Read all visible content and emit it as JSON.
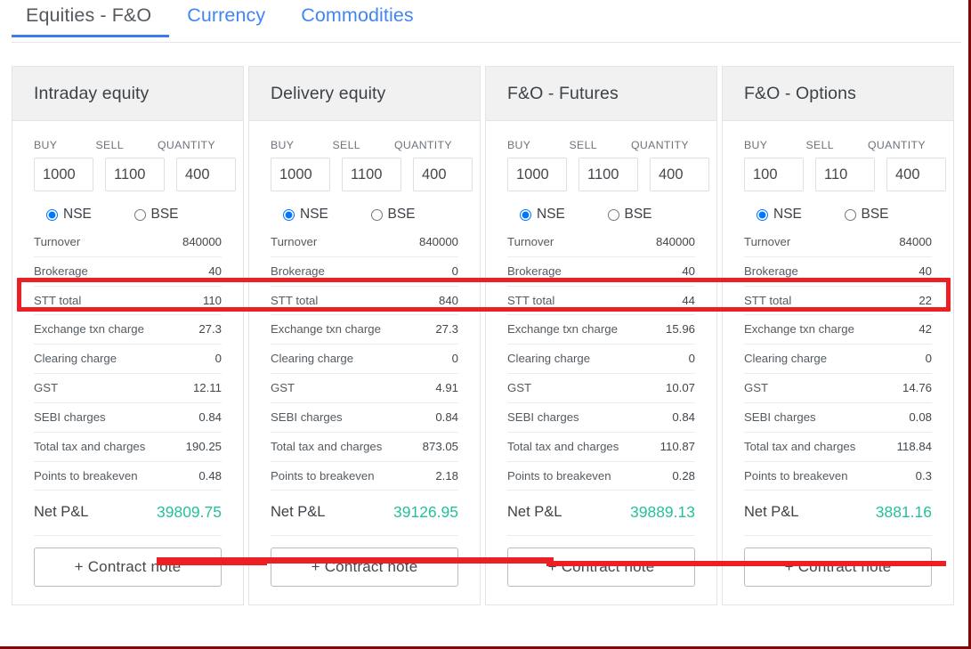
{
  "tabs": [
    {
      "label": "Equities - F&O",
      "active": true
    },
    {
      "label": "Currency",
      "active": false
    },
    {
      "label": "Commodities",
      "active": false
    }
  ],
  "field_labels": {
    "buy": "BUY",
    "sell": "SELL",
    "quantity": "QUANTITY"
  },
  "exchanges": {
    "nse": "NSE",
    "bse": "BSE"
  },
  "row_labels": {
    "turnover": "Turnover",
    "brokerage": "Brokerage",
    "stt_total": "STT total",
    "exchange_txn_charge": "Exchange txn charge",
    "clearing_charge": "Clearing charge",
    "gst": "GST",
    "sebi_charges": "SEBI charges",
    "total_tax_and_charges": "Total tax and charges",
    "points_to_breakeven": "Points to breakeven",
    "net_pl": "Net P&L"
  },
  "contract_note_label": "+ Contract note",
  "colors": {
    "accent_blue": "#3f7ceb",
    "tab_link": "#4285f4",
    "profit_green": "#26c09a",
    "annotation_red": "#ec2024",
    "page_border_red": "#7d0a0a",
    "card_header_bg": "#f1f1f1"
  },
  "annotations": {
    "brokerage_highlight": "red rectangle around the Brokerage row across all four cards",
    "netpl_underline": "red underline beneath the Net P&L row across all four cards"
  },
  "cards": [
    {
      "title": "Intraday equity",
      "buy": "1000",
      "sell": "1100",
      "quantity": "400",
      "exchange_selected": "NSE",
      "values": {
        "turnover": "840000",
        "brokerage": "40",
        "stt_total": "110",
        "exchange_txn_charge": "27.3",
        "clearing_charge": "0",
        "gst": "12.11",
        "sebi_charges": "0.84",
        "total_tax_and_charges": "190.25",
        "points_to_breakeven": "0.48",
        "net_pl": "39809.75"
      }
    },
    {
      "title": "Delivery equity",
      "buy": "1000",
      "sell": "1100",
      "quantity": "400",
      "exchange_selected": "NSE",
      "values": {
        "turnover": "840000",
        "brokerage": "0",
        "stt_total": "840",
        "exchange_txn_charge": "27.3",
        "clearing_charge": "0",
        "gst": "4.91",
        "sebi_charges": "0.84",
        "total_tax_and_charges": "873.05",
        "points_to_breakeven": "2.18",
        "net_pl": "39126.95"
      }
    },
    {
      "title": "F&O - Futures",
      "buy": "1000",
      "sell": "1100",
      "quantity": "400",
      "exchange_selected": "NSE",
      "values": {
        "turnover": "840000",
        "brokerage": "40",
        "stt_total": "44",
        "exchange_txn_charge": "15.96",
        "clearing_charge": "0",
        "gst": "10.07",
        "sebi_charges": "0.84",
        "total_tax_and_charges": "110.87",
        "points_to_breakeven": "0.28",
        "net_pl": "39889.13"
      }
    },
    {
      "title": "F&O - Options",
      "buy": "100",
      "sell": "110",
      "quantity": "400",
      "exchange_selected": "NSE",
      "values": {
        "turnover": "84000",
        "brokerage": "40",
        "stt_total": "22",
        "exchange_txn_charge": "42",
        "clearing_charge": "0",
        "gst": "14.76",
        "sebi_charges": "0.08",
        "total_tax_and_charges": "118.84",
        "points_to_breakeven": "0.3",
        "net_pl": "3881.16"
      }
    }
  ]
}
